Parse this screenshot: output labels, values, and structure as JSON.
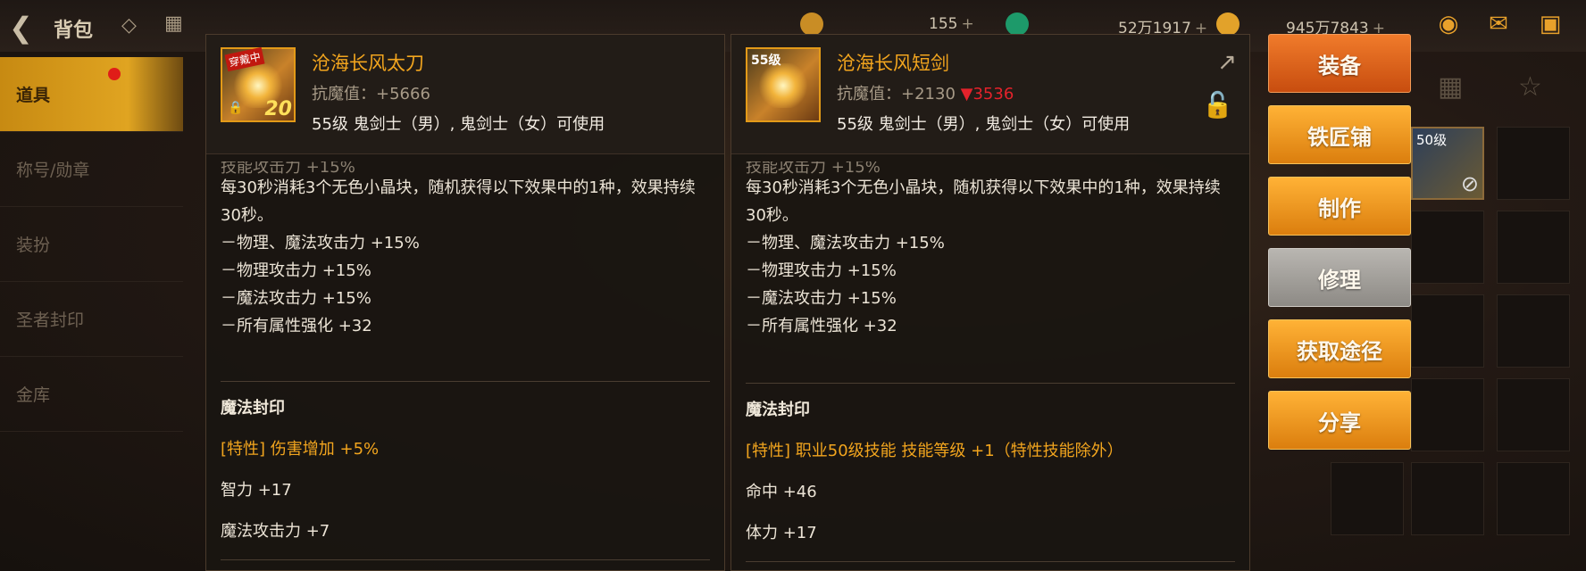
{
  "topbar": {
    "back_icon": "arrow-left-icon",
    "title": "背包",
    "currency1": "155",
    "currency2": "52万1917",
    "currency3": "945万7843",
    "plus": "+"
  },
  "nav": {
    "items": [
      {
        "label": "道具",
        "active": true
      },
      {
        "label": "称号/勋章"
      },
      {
        "label": "装扮"
      },
      {
        "label": "圣者封印"
      },
      {
        "label": "金库"
      }
    ]
  },
  "left_item": {
    "name": "沧海长风太刀",
    "icon_tag": "穿戴中",
    "icon_number": "20",
    "resist_label": "抗魔值：",
    "resist_value": "+5666",
    "usable": "55级 鬼剑士（男）, 鬼剑士（女）可使用",
    "cut_line": "技能攻击力 +15%",
    "effect_desc": "每30秒消耗3个无色小晶块，随机获得以下效果中的1种，效果持续30秒。",
    "effects": [
      "－物理、魔法攻击力 +15%",
      "－物理攻击力 +15%",
      "－魔法攻击力 +15%",
      "－所有属性强化 +32"
    ],
    "seal_title": "魔法封印",
    "trait": "[特性] 伤害增加 +5%",
    "stats": [
      "智力 +17",
      "魔法攻击力 +7"
    ]
  },
  "right_item": {
    "name": "沧海长风短剑",
    "icon_level": "55级",
    "resist_label": "抗魔值：",
    "resist_value": "+2130",
    "resist_delta": "▼3536",
    "usable": "55级 鬼剑士（男）, 鬼剑士（女）可使用",
    "cut_line": "技能攻击力 +15%",
    "effect_desc": "每30秒消耗3个无色小晶块，随机获得以下效果中的1种，效果持续30秒。",
    "effects": [
      "－物理、魔法攻击力 +15%",
      "－物理攻击力 +15%",
      "－魔法攻击力 +15%",
      "－所有属性强化 +32"
    ],
    "seal_title": "魔法封印",
    "trait": "[特性] 职业50级技能 技能等级 +1（特性技能除外）",
    "stats": [
      "命中 +46",
      "体力 +17"
    ]
  },
  "actions": {
    "equip": "装备",
    "blacksmith": "铁匠铺",
    "craft": "制作",
    "repair": "修理",
    "obtain": "获取途径",
    "share": "分享"
  },
  "inventory": {
    "slot_level": "50级"
  },
  "colors": {
    "accent_orange": "#f2a51e",
    "button_orange": "#db7e0e",
    "down_red": "#e4222b"
  }
}
